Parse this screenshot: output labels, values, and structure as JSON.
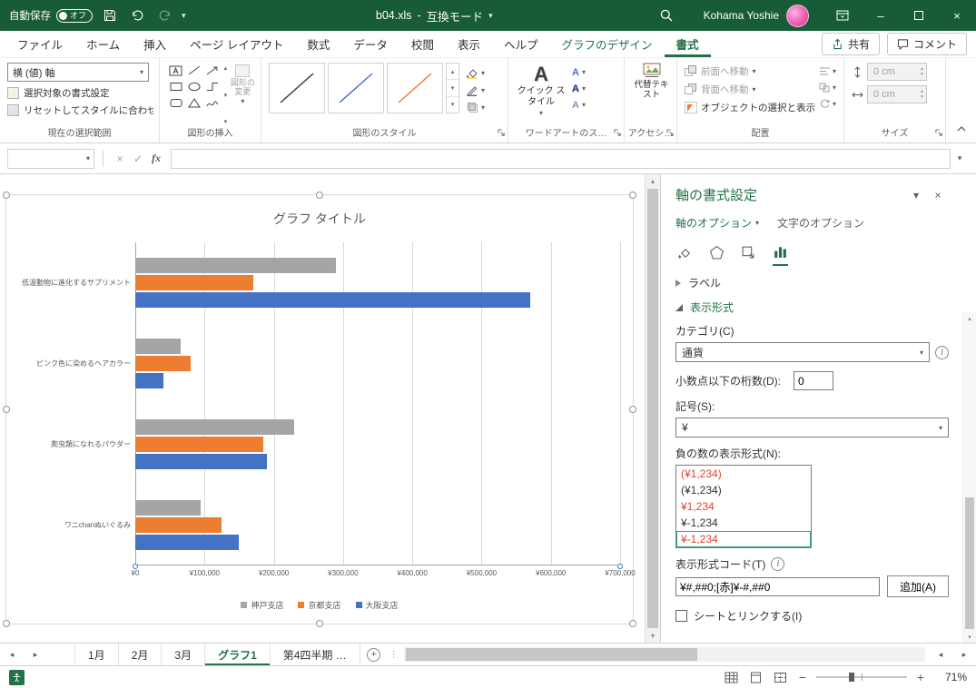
{
  "colors": {
    "titlebar_green": "#185C37",
    "accent_green": "#217346",
    "bar_gray": "#A5A5A5",
    "bar_orange": "#ED7D31",
    "bar_blue": "#4472C4",
    "negative_red": "#E8432D",
    "selection_teal": "#2BA394"
  },
  "icons": {
    "caret_down": "▾",
    "caret_up": "▴",
    "caret_left": "◂",
    "caret_right": "▸",
    "close": "×",
    "minimize": "–",
    "check": "✓",
    "cancel": "×",
    "plus": "+",
    "fx": "fx",
    "info": "i",
    "ellipsis_v": "⋮",
    "collapse_ribbon": "⌃"
  },
  "titlebar": {
    "autosave_label": "自動保存",
    "autosave_state": "オフ",
    "filename": "b04.xls",
    "separator": "-",
    "mode": "互換モード",
    "user_name": "Kohama Yoshie"
  },
  "ribbon_tabs": {
    "items": [
      {
        "label": "ファイル",
        "contextual": false,
        "active": false
      },
      {
        "label": "ホーム",
        "contextual": false,
        "active": false
      },
      {
        "label": "挿入",
        "contextual": false,
        "active": false
      },
      {
        "label": "ページ レイアウト",
        "contextual": false,
        "active": false
      },
      {
        "label": "数式",
        "contextual": false,
        "active": false
      },
      {
        "label": "データ",
        "contextual": false,
        "active": false
      },
      {
        "label": "校閲",
        "contextual": false,
        "active": false
      },
      {
        "label": "表示",
        "contextual": false,
        "active": false
      },
      {
        "label": "ヘルプ",
        "contextual": false,
        "active": false
      },
      {
        "label": "グラフのデザイン",
        "contextual": true,
        "active": false
      },
      {
        "label": "書式",
        "contextual": true,
        "active": true
      }
    ],
    "share_label": "共有",
    "comments_label": "コメント"
  },
  "ribbon": {
    "groups": {
      "current_selection": {
        "label": "現在の選択範囲",
        "selector_value": "横 (値) 軸",
        "format_selection": "選択対象の書式設定",
        "reset_style": "リセットしてスタイルに合わせる"
      },
      "insert_shapes": {
        "label": "図形の挿入",
        "change_shape": "図形の変更"
      },
      "shape_styles": {
        "label": "図形のスタイル"
      },
      "wordart": {
        "label": "ワードアートのス…",
        "quick_styles": "クイック スタイル"
      },
      "accessibility": {
        "label": "アクセシ…",
        "alt_text": "代替テキスト"
      },
      "arrange": {
        "label": "配置",
        "bring_forward": "前面へ移動",
        "send_backward": "背面へ移動",
        "selection_pane": "オブジェクトの選択と表示"
      },
      "size": {
        "label": "サイズ",
        "height_value": "0 cm",
        "width_value": "0 cm"
      }
    }
  },
  "task_pane": {
    "title": "軸の書式設定",
    "tab_axis_options": "軸のオプション",
    "tab_text_options": "文字のオプション",
    "section_labels": "ラベル",
    "section_number_format": "表示形式",
    "category_label": "カテゴリ(C)",
    "category_value": "通貨",
    "decimals_label": "小数点以下の桁数(D):",
    "decimals_value": "0",
    "symbol_label": "記号(S):",
    "symbol_value": "¥",
    "negative_label": "負の数の表示形式(N):",
    "negative_options": [
      {
        "text": "(¥1,234)",
        "red": true,
        "selected": false
      },
      {
        "text": "(¥1,234)",
        "red": false,
        "selected": false
      },
      {
        "text": "¥1,234",
        "red": true,
        "selected": false
      },
      {
        "text": "¥-1,234",
        "red": false,
        "selected": false
      },
      {
        "text": "¥-1,234",
        "red": true,
        "selected": true
      }
    ],
    "format_code_label": "表示形式コード(T)",
    "format_code_value": "¥#,##0;[赤]¥-#,##0",
    "add_button": "追加(A)",
    "link_checkbox_label": "シートとリンクする(I)"
  },
  "chart_data": {
    "type": "bar",
    "orientation": "horizontal",
    "title": "グラフ タイトル",
    "categories": [
      "低温動物に進化するサプリメント",
      "ピンク色に染めるヘアカラー",
      "爬虫類になれるパウダー",
      "ワニchanぬいぐるみ"
    ],
    "series": [
      {
        "name": "神戸支店",
        "color": "#A5A5A5",
        "values": [
          290000,
          65000,
          230000,
          95000
        ]
      },
      {
        "name": "京都支店",
        "color": "#ED7D31",
        "values": [
          170000,
          80000,
          185000,
          125000
        ]
      },
      {
        "name": "大阪支店",
        "color": "#4472C4",
        "values": [
          570000,
          40000,
          190000,
          150000
        ]
      }
    ],
    "x_ticks": [
      "¥0",
      "¥100,000",
      "¥200,000",
      "¥300,000",
      "¥400,000",
      "¥500,000",
      "¥600,000",
      "¥700,000"
    ],
    "xlim": [
      0,
      700000
    ],
    "legend_position": "bottom",
    "gridlines": true
  },
  "sheet_tabs": {
    "tabs": [
      {
        "label": "1月",
        "active": false
      },
      {
        "label": "2月",
        "active": false
      },
      {
        "label": "3月",
        "active": false
      },
      {
        "label": "グラフ1",
        "active": true
      },
      {
        "label": "第4四半期 …",
        "active": false
      }
    ]
  },
  "status_bar": {
    "zoom_label": "71%"
  }
}
